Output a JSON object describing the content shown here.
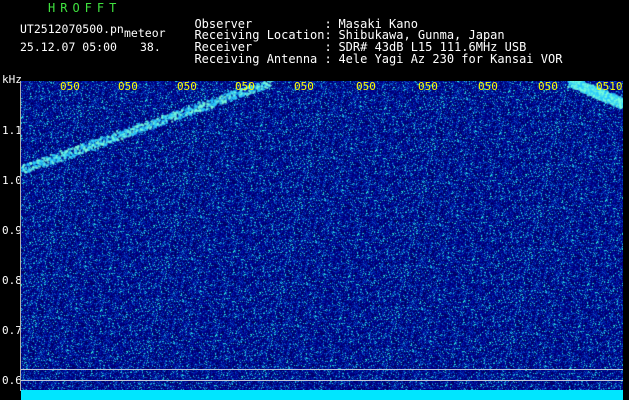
{
  "header": {
    "title": "HROFFT",
    "filename": "UT2512070500.pn",
    "filename_suffix": "meteor",
    "datetime": "25.12.07 05:00",
    "count": "38."
  },
  "info": [
    {
      "label": "Observer",
      "value": "Masaki Kano"
    },
    {
      "label": "Receiving Location",
      "value": "Shibukawa, Gunma, Japan"
    },
    {
      "label": "Receiver",
      "value": "SDR# 43dB L15 111.6MHz USB"
    },
    {
      "label": "Receiving Antenna",
      "value": "4ele Yagi Az 230 for Kansai VOR"
    }
  ],
  "y_axis": {
    "unit": "kHz",
    "labels": [
      "1.1",
      "1.0",
      "0.9",
      "0.8",
      "0.7",
      "0.6"
    ]
  },
  "time_ticks": [
    "050",
    "050",
    "050",
    "050",
    "050",
    "050",
    "050",
    "050",
    "050",
    "050",
    "0510"
  ],
  "colors": {
    "background": "#000000",
    "title_green": "#3fe23f",
    "tick_yellow": "#ffff00",
    "baseline_cyan": "#00e6ff"
  }
}
